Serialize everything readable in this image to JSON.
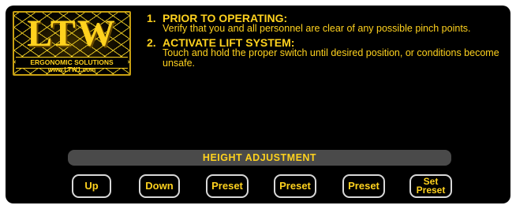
{
  "logo": {
    "main_text": "LTW",
    "tagline": "ERGONOMIC SOLUTIONS",
    "url": "www.LTW1.com"
  },
  "instructions": [
    {
      "number": "1.",
      "title": "PRIOR TO OPERATING:",
      "body": "Verify that you and all personnel are clear of any possible pinch points."
    },
    {
      "number": "2.",
      "title": "ACTIVATE LIFT SYSTEM:",
      "body": "Touch and hold the proper switch until desired position, or conditions become unsafe."
    }
  ],
  "height_adjustment": {
    "label": "HEIGHT ADJUSTMENT"
  },
  "buttons": {
    "up": "Up",
    "down": "Down",
    "preset_1": "Preset",
    "preset_2": "Preset",
    "preset_3": "Preset",
    "set_preset_line1": "Set",
    "set_preset_line2": "Preset"
  },
  "colors": {
    "accent": "#ffd21e",
    "panel": "#000000",
    "bar": "#4a4a4a",
    "button_border": "#d8d8d8"
  }
}
